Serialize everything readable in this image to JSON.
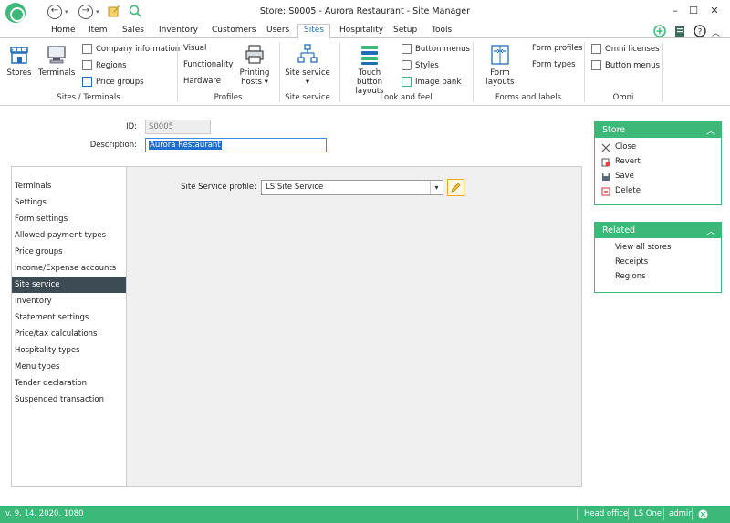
{
  "window": {
    "title": "Store: S0005 - Aurora Restaurant - Site Manager",
    "controls": [
      "–",
      "☐",
      "✕"
    ]
  },
  "menu": {
    "items": [
      "Home",
      "Item",
      "Sales",
      "Inventory",
      "Customers",
      "Users",
      "Sites",
      "Hospitality",
      "Setup",
      "Tools"
    ],
    "active": "Sites"
  },
  "ribbon": {
    "groups": [
      {
        "label": "Sites / Terminals"
      },
      {
        "label": "Profiles"
      },
      {
        "label": "Site service"
      },
      {
        "label": "Look and feel"
      },
      {
        "label": "Forms and labels"
      },
      {
        "label": "Omni"
      }
    ],
    "big_buttons": {
      "stores": "Stores",
      "terminals": "Terminals",
      "printing_hosts": "Printing hosts ▾",
      "site_service": "Site service",
      "site_service_arrow": "▾",
      "touch_button_layouts": "Touch button layouts",
      "form_layouts": "Form layouts"
    },
    "small_buttons": {
      "company_information": "Company information",
      "regions": "Regions",
      "price_groups": "Price groups",
      "visual": "Visual",
      "functionality": "Functionality",
      "hardware": "Hardware",
      "button_menus": "Button menus",
      "styles": "Styles",
      "image_bank": "Image bank",
      "form_profiles": "Form profiles",
      "form_types": "Form types",
      "omni_licenses": "Omni licenses",
      "omni_button_menus": "Button menus"
    }
  },
  "form": {
    "id_label": "ID:",
    "id_value": "S0005",
    "description_label": "Description:",
    "description_value": "Aurora Restaurant"
  },
  "nav": {
    "items": [
      "Terminals",
      "Settings",
      "Form settings",
      "Allowed payment types",
      "Price groups",
      "Income/Expense accounts",
      "Site service",
      "Inventory",
      "Statement settings",
      "Price/tax calculations",
      "Hospitality types",
      "Menu types",
      "Tender declaration",
      "Suspended transaction"
    ],
    "active": "Site service"
  },
  "detail": {
    "profile_label": "Site Service profile:",
    "profile_value": "LS Site Service"
  },
  "store_panel": {
    "title": "Store",
    "collapse": "︿",
    "items": [
      "Close",
      "Revert",
      "Save",
      "Delete"
    ]
  },
  "related_panel": {
    "title": "Related",
    "collapse": "︿",
    "items": [
      "View all stores",
      "Receipts",
      "Regions"
    ]
  },
  "status": {
    "version": "v. 9. 14. 2020. 1080",
    "head_office": "Head office",
    "product": "LS One",
    "user": "admin"
  },
  "colors": {
    "accent": "#3cb878",
    "nav_active": "#3d4b55",
    "link_blue": "#1e6fb8"
  }
}
